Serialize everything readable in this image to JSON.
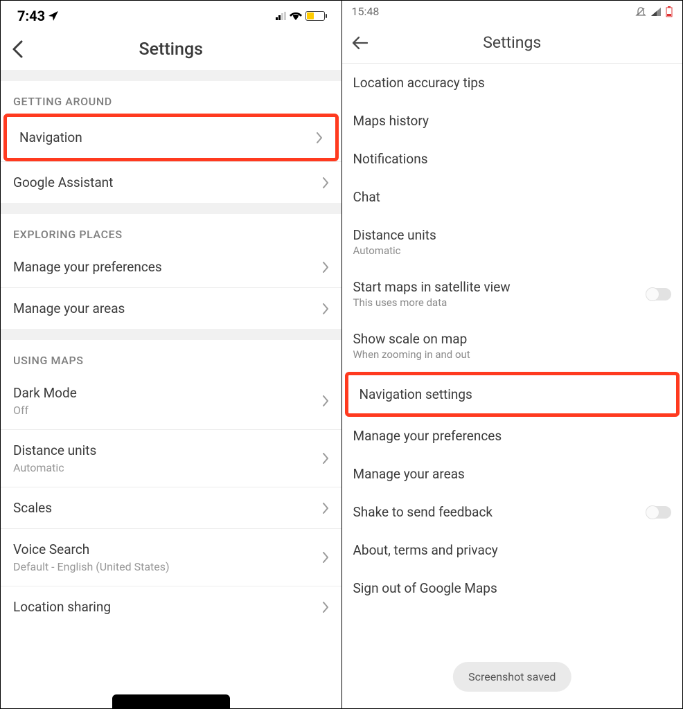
{
  "left": {
    "statusbar": {
      "time": "7:43"
    },
    "header": {
      "title": "Settings"
    },
    "sections": {
      "getting_around": {
        "title": "GETTING AROUND",
        "items": {
          "navigation": "Navigation",
          "google_assistant": "Google Assistant"
        }
      },
      "exploring_places": {
        "title": "EXPLORING PLACES",
        "items": {
          "manage_preferences": "Manage your preferences",
          "manage_areas": "Manage your areas"
        }
      },
      "using_maps": {
        "title": "USING MAPS",
        "items": {
          "dark_mode": {
            "label": "Dark Mode",
            "value": "Off"
          },
          "distance_units": {
            "label": "Distance units",
            "value": "Automatic"
          },
          "scales": "Scales",
          "voice_search": {
            "label": "Voice Search",
            "value": "Default - English (United States)"
          },
          "location_sharing": "Location sharing"
        }
      }
    }
  },
  "right": {
    "statusbar": {
      "time": "15:48"
    },
    "header": {
      "title": "Settings"
    },
    "items": {
      "location_accuracy": "Location accuracy tips",
      "maps_history": "Maps history",
      "notifications": "Notifications",
      "chat": "Chat",
      "distance_units": {
        "label": "Distance units",
        "value": "Automatic"
      },
      "satellite": {
        "label": "Start maps in satellite view",
        "sub": "This uses more data"
      },
      "scale": {
        "label": "Show scale on map",
        "sub": "When zooming in and out"
      },
      "navigation_settings": "Navigation settings",
      "manage_preferences": "Manage your preferences",
      "manage_areas": "Manage your areas",
      "shake_feedback": "Shake to send feedback",
      "about": "About, terms and privacy",
      "sign_out": "Sign out of Google Maps"
    },
    "toast": "Screenshot saved"
  }
}
